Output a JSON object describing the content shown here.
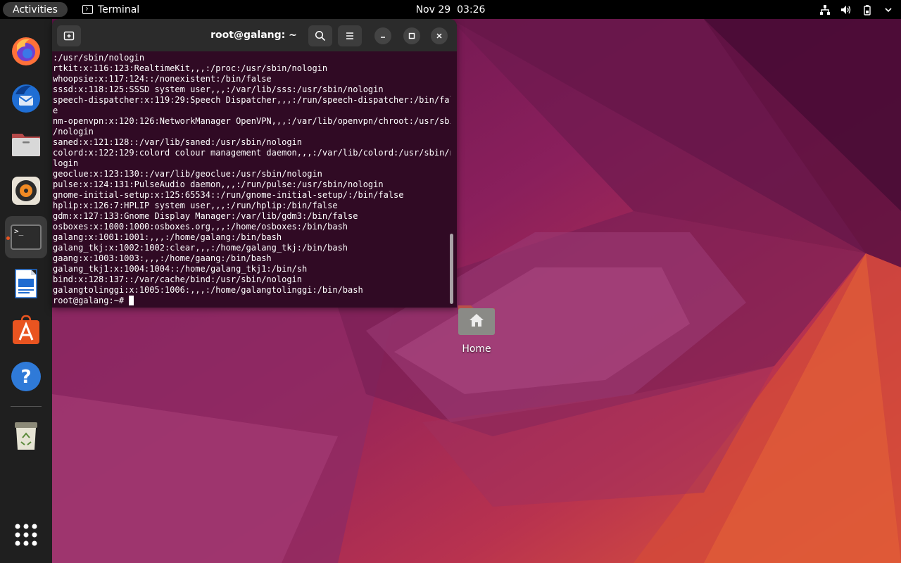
{
  "topbar": {
    "activities_label": "Activities",
    "app_name": "Terminal",
    "date": "Nov 29",
    "time": "03:26"
  },
  "dock": {
    "items": [
      {
        "name": "firefox",
        "icon": "firefox-icon"
      },
      {
        "name": "thunderbird",
        "icon": "thunderbird-icon"
      },
      {
        "name": "files",
        "icon": "files-icon"
      },
      {
        "name": "rhythmbox",
        "icon": "rhythmbox-icon"
      },
      {
        "name": "terminal",
        "icon": "terminal-icon",
        "active": true
      },
      {
        "name": "libreoffice-writer",
        "icon": "writer-icon"
      },
      {
        "name": "software",
        "icon": "software-icon"
      },
      {
        "name": "help",
        "icon": "help-icon"
      },
      {
        "name": "trash",
        "icon": "trash-icon"
      },
      {
        "name": "show-apps",
        "icon": "app-grid-icon"
      }
    ],
    "terminal_glyph": ">_"
  },
  "terminal": {
    "title": "root@galang: ~",
    "lines": [
      ":/usr/sbin/nologin",
      "rtkit:x:116:123:RealtimeKit,,,:/proc:/usr/sbin/nologin",
      "whoopsie:x:117:124::/nonexistent:/bin/false",
      "sssd:x:118:125:SSSD system user,,,:/var/lib/sss:/usr/sbin/nologin",
      "speech-dispatcher:x:119:29:Speech Dispatcher,,,:/run/speech-dispatcher:/bin/fals",
      "e",
      "nm-openvpn:x:120:126:NetworkManager OpenVPN,,,:/var/lib/openvpn/chroot:/usr/sbin",
      "/nologin",
      "saned:x:121:128::/var/lib/saned:/usr/sbin/nologin",
      "colord:x:122:129:colord colour management daemon,,,:/var/lib/colord:/usr/sbin/no",
      "login",
      "geoclue:x:123:130::/var/lib/geoclue:/usr/sbin/nologin",
      "pulse:x:124:131:PulseAudio daemon,,,:/run/pulse:/usr/sbin/nologin",
      "gnome-initial-setup:x:125:65534::/run/gnome-initial-setup/:/bin/false",
      "hplip:x:126:7:HPLIP system user,,,:/run/hplip:/bin/false",
      "gdm:x:127:133:Gnome Display Manager:/var/lib/gdm3:/bin/false",
      "osboxes:x:1000:1000:osboxes.org,,,:/home/osboxes:/bin/bash",
      "galang:x:1001:1001:,,,:/home/galang:/bin/bash",
      "galang_tkj:x:1002:1002:clear,,,:/home/galang_tkj:/bin/bash",
      "gaang:x:1003:1003:,,,:/home/gaang:/bin/bash",
      "galang_tkj1:x:1004:1004::/home/galang_tkj1:/bin/sh",
      "bind:x:128:137::/var/cache/bind:/usr/sbin/nologin",
      "galangtolinggi:x:1005:1006:,,,:/home/galangtolinggi:/bin/bash"
    ],
    "prompt": "root@galang:~# "
  },
  "desktop": {
    "home_label": "Home"
  },
  "colors": {
    "terminal_bg": "#300a24",
    "header_bg": "#2b2b2b",
    "accent": "#e95420"
  }
}
